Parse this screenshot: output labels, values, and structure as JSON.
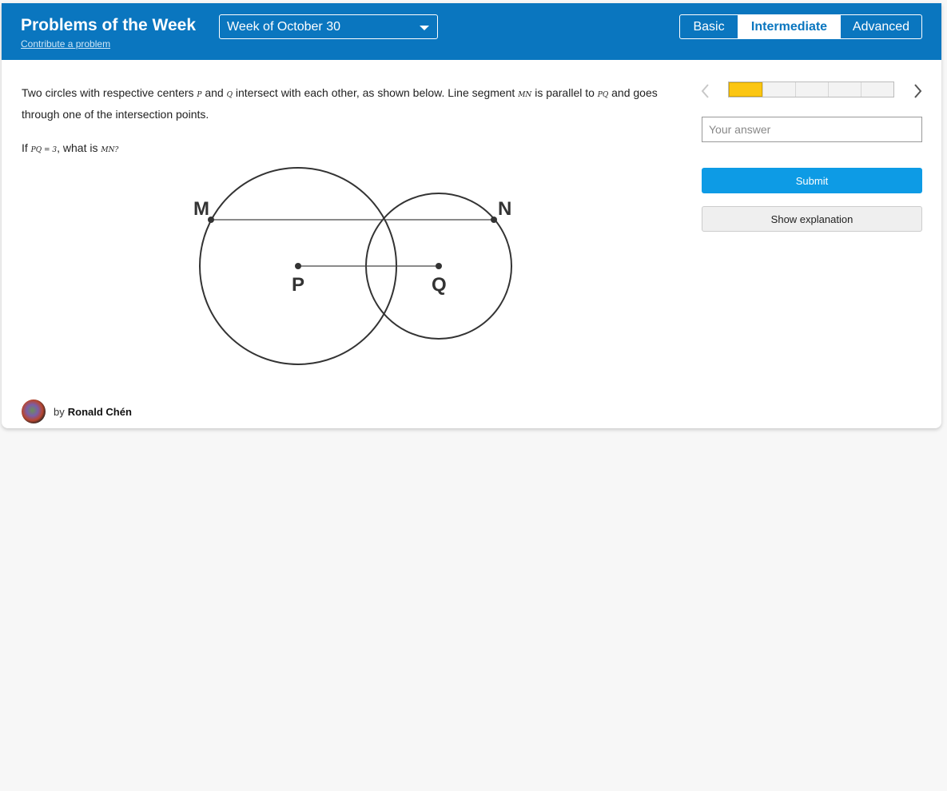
{
  "header": {
    "title": "Problems of the Week",
    "contribute_link": "Contribute a problem",
    "week_select": {
      "value": "Week of October 30"
    },
    "levels": [
      {
        "label": "Basic",
        "active": false
      },
      {
        "label": "Intermediate",
        "active": true
      },
      {
        "label": "Advanced",
        "active": false
      }
    ]
  },
  "problem": {
    "text1_a": "Two circles with respective centers ",
    "var_p": "P",
    "text1_b": " and ",
    "var_q": "Q",
    "text1_c": " intersect with each other, as shown below. Line segment ",
    "var_mn": "MN",
    "text1_d": " is parallel to ",
    "var_pq": "PQ",
    "text1_e": " and goes through one of the intersection points.",
    "text2_a": "If ",
    "eq": "PQ = 3",
    "text2_b": ", what is ",
    "var_mn2": "MN?"
  },
  "figure": {
    "labels": {
      "m": "M",
      "n": "N",
      "p": "P",
      "q": "Q"
    }
  },
  "sidebar": {
    "progress": {
      "total": 5,
      "current": 1
    },
    "answer_placeholder": "Your answer",
    "submit_label": "Submit",
    "explanation_label": "Show explanation"
  },
  "author": {
    "by": "by",
    "name": "Ronald Chén"
  },
  "colors": {
    "header_bg": "#0a76bf",
    "submit_bg": "#0d9be5",
    "progress_current": "#fbc613"
  }
}
